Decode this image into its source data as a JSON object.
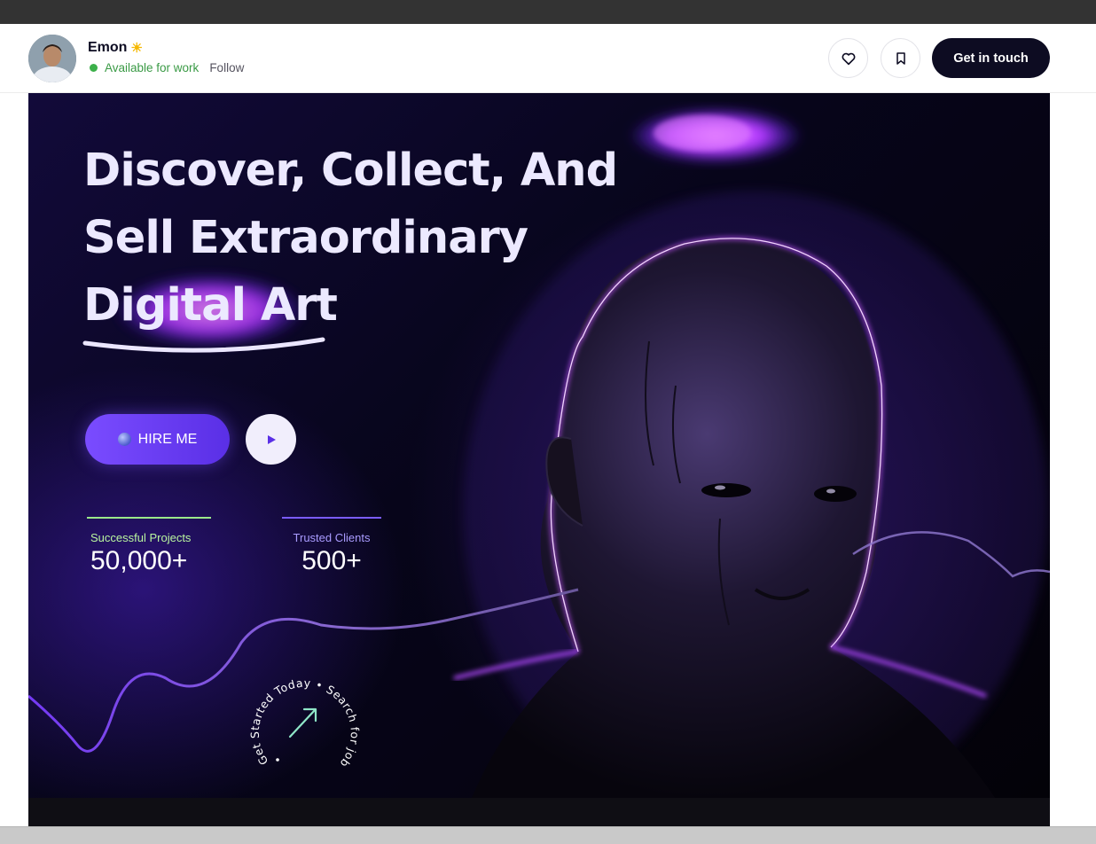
{
  "header": {
    "author_name": "Emon",
    "status": "Available for work",
    "follow_label": "Follow",
    "cta_label": "Get in touch",
    "colors": {
      "cta_bg": "#0d0c22",
      "status_dot": "#3cb04a"
    }
  },
  "hero": {
    "headline_line1": "Discover, Collect, And",
    "headline_line2": "Sell Extraordinary",
    "headline_line3": "Digital Art",
    "hire_label": "HIRE ME",
    "stats": [
      {
        "label": "Successful Projects",
        "value": "50,000+"
      },
      {
        "label": "Trusted Clients",
        "value": "500+"
      }
    ],
    "badge_text": "Get Started Today • Search for job • Sear",
    "colors": {
      "accent": "#7a4cff",
      "glow": "#b44cff",
      "background": "#07051a"
    }
  },
  "icons": {
    "like": "heart-icon",
    "save": "bookmark-icon",
    "play": "play-icon",
    "badge_arrow": "arrow-up-right-icon"
  }
}
